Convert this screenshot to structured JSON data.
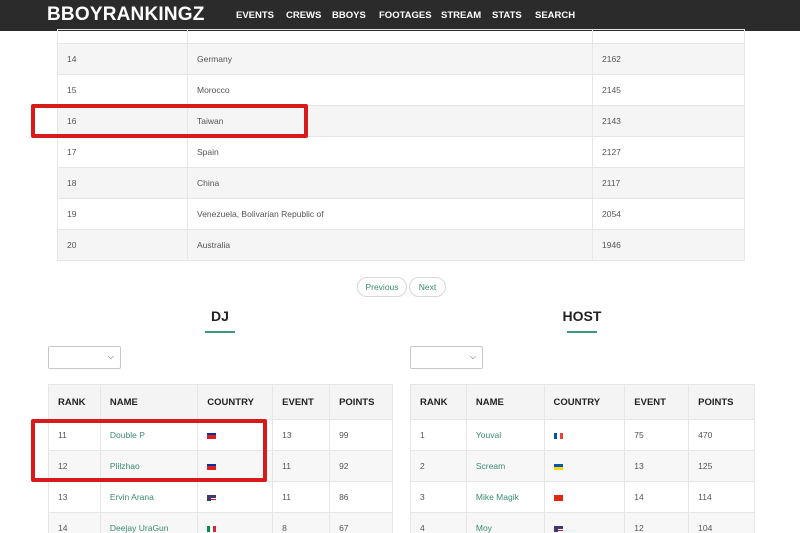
{
  "navbar": {
    "brand": "BBOYRANKINGZ",
    "items": [
      {
        "label": "EVENTS"
      },
      {
        "label": "CREWS"
      },
      {
        "label": "BBOYS"
      },
      {
        "label": "FOOTAGES"
      },
      {
        "label": "STREAM"
      },
      {
        "label": "STATS"
      },
      {
        "label": "SEARCH"
      }
    ]
  },
  "country_table": {
    "rows": [
      {
        "rank": "",
        "country": "",
        "points": ""
      },
      {
        "rank": "14",
        "country": "Germany",
        "points": "2162"
      },
      {
        "rank": "15",
        "country": "Morocco",
        "points": "2145"
      },
      {
        "rank": "16",
        "country": "Taiwan",
        "points": "2143"
      },
      {
        "rank": "17",
        "country": "Spain",
        "points": "2127"
      },
      {
        "rank": "18",
        "country": "China",
        "points": "2117"
      },
      {
        "rank": "19",
        "country": "Venezuela, Bolivarian Republic of",
        "points": "2054"
      },
      {
        "rank": "20",
        "country": "Australia",
        "points": "1946"
      }
    ]
  },
  "pagination": {
    "previous": "Previous",
    "next": "Next"
  },
  "dj": {
    "title": "DJ",
    "select_value": "",
    "headers": [
      "RANK",
      "NAME",
      "COUNTRY",
      "EVENT",
      "POINTS"
    ],
    "rows": [
      {
        "rank": "11",
        "name": "Double P",
        "flag": "taiwan-flag-icon",
        "event": "13",
        "points": "99"
      },
      {
        "rank": "12",
        "name": "Plilzhao",
        "flag": "taiwan-flag-icon",
        "event": "11",
        "points": "92"
      },
      {
        "rank": "13",
        "name": "Ervin Arana",
        "flag": "usa-flag-icon",
        "event": "11",
        "points": "86"
      },
      {
        "rank": "14",
        "name": "Deejay UraGun",
        "flag": "italy-flag-icon",
        "event": "8",
        "points": "67"
      }
    ]
  },
  "host": {
    "title": "HOST",
    "select_value": "",
    "headers": [
      "RANK",
      "NAME",
      "COUNTRY",
      "EVENT",
      "POINTS"
    ],
    "rows": [
      {
        "rank": "1",
        "name": "Youval",
        "flag": "france-flag-icon",
        "event": "75",
        "points": "470"
      },
      {
        "rank": "2",
        "name": "Scream",
        "flag": "ukraine-flag-icon",
        "event": "13",
        "points": "125"
      },
      {
        "rank": "3",
        "name": "Mike Magik",
        "flag": "china-flag-icon",
        "event": "14",
        "points": "114"
      },
      {
        "rank": "4",
        "name": "Moy",
        "flag": "usa-flag-icon",
        "event": "12",
        "points": "104"
      }
    ]
  },
  "colors": {
    "navbar_bg": "#2b2b2b",
    "accent": "#3a8a74",
    "annotation": "#d81a1a"
  }
}
